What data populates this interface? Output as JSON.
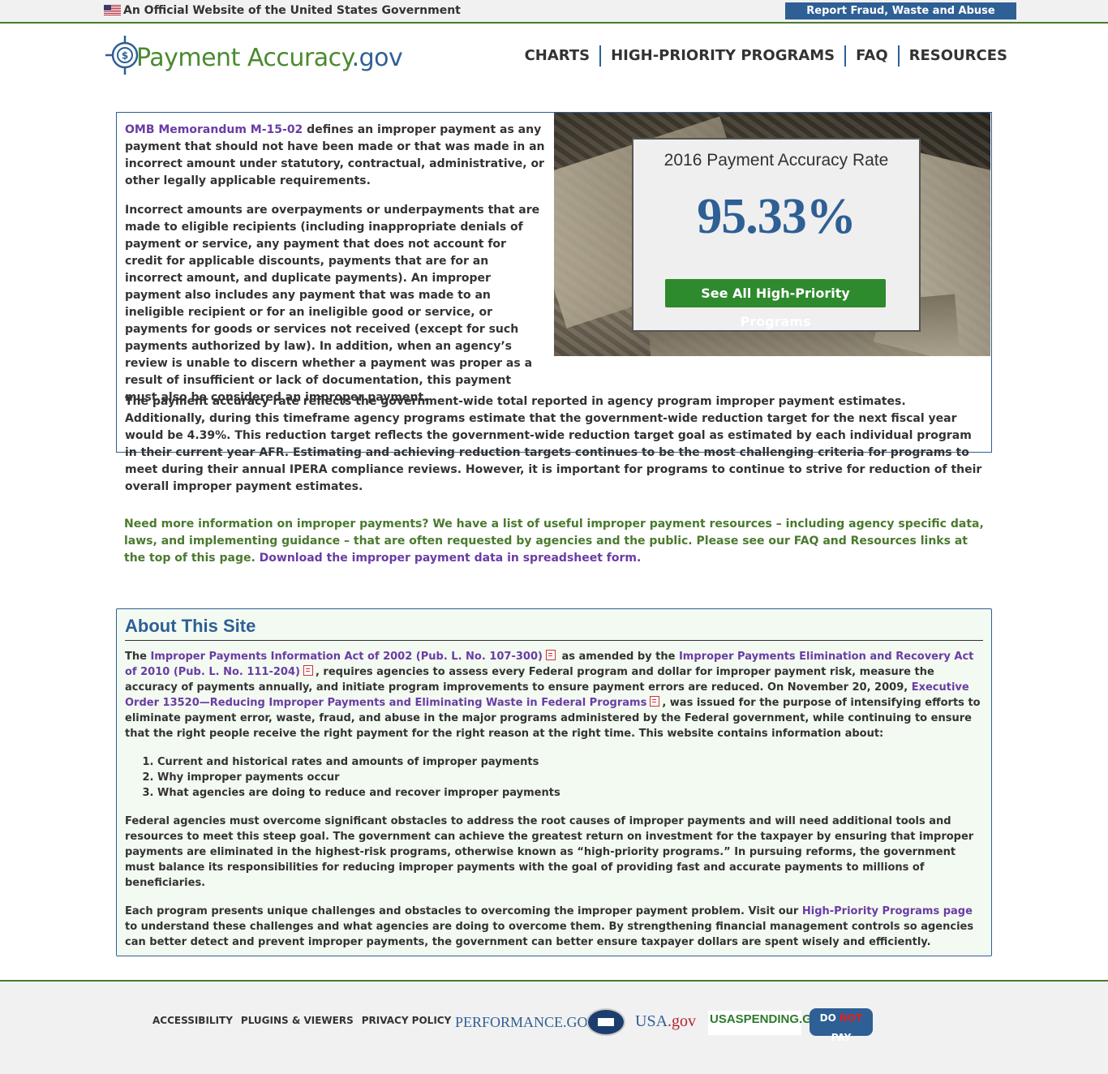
{
  "gov_bar": {
    "official_text": "An Official Website of the United States Government",
    "report_button": "Report Fraud, Waste and Abuse"
  },
  "header": {
    "logo_main": "Payment Accuracy",
    "logo_suffix": ".gov",
    "nav": [
      "CHARTS",
      "HIGH-PRIORITY PROGRAMS",
      "FAQ",
      "RESOURCES"
    ]
  },
  "intro": {
    "p1_link": "OMB Memorandum M-15-02",
    "p1_text": " defines an improper payment as any payment that should not have been made or that was made in an incorrect amount under statutory, contractual, administrative, or other legally applicable requirements.",
    "p2_text": "Incorrect amounts are overpayments or underpayments that are made to eligible recipients (including inappropriate denials of payment or service, any payment that does not account for credit for applicable discounts, payments that are for an incorrect amount, and duplicate payments). An improper payment also includes any payment that was made to an ineligible recipient or for an ineligible good or service, or payments for goods or services not received (except for such payments authorized by law). In addition, when an agency’s review is unable to discern whether a payment was proper as a result of insufficient or lack of documentation, this payment must also be considered an improper payment."
  },
  "rate_card": {
    "title": "2016 Payment Accuracy Rate",
    "value": "95.33%",
    "button": "See All High-Priority Programs"
  },
  "rate_paragraph": "The payment accuracy rate reflects the government-wide total reported in agency program improper payment estimates. Additionally, during this timeframe agency programs estimate that the government-wide reduction target for the next fiscal year would be 4.39%. This reduction target reflects the government-wide reduction target goal as estimated by each individual program in their current year AFR. Estimating and achieving reduction targets continues to be the most challenging criteria for programs to meet during their annual IPERA compliance reviews. However, it is important for programs to continue to strive for reduction of their overall improper payment estimates.",
  "more_info": {
    "text": "Need more information on improper payments? We have a list of useful improper payment resources – including agency specific data, laws, and implementing guidance – that are often requested by agencies and the public. Please see our FAQ and Resources links at the top of this page. ",
    "link": "Download the improper payment data in spreadsheet form."
  },
  "about": {
    "title": "About This Site",
    "p1_a": "The ",
    "p1_link1": "Improper Payments Information Act of 2002 (Pub. L. No. 107-300)",
    "p1_b": " as amended by the ",
    "p1_link2": "Improper Payments Elimination and Recovery Act of 2010 (Pub. L. No. 111-204)",
    "p1_c": ", requires agencies to assess every Federal program and dollar for improper payment risk, measure the accuracy of payments annually, and initiate program improvements to ensure payment errors are reduced. On November 20, 2009, ",
    "p1_link3": "Executive Order 13520—Reducing Improper Payments and Eliminating Waste in Federal Programs",
    "p1_d": ", was issued for the purpose of intensifying efforts to eliminate payment error, waste, fraud, and abuse in the major programs administered by the Federal government, while continuing to ensure that the right people receive the right payment for the right reason at the right time. This website contains information about:",
    "list": [
      "Current and historical rates and amounts of improper payments",
      "Why improper payments occur",
      "What agencies are doing to reduce and recover improper payments"
    ],
    "p2": "Federal agencies must overcome significant obstacles to address the root causes of improper payments and will need additional tools and resources to meet this steep goal. The government can achieve the greatest return on investment for the taxpayer by ensuring that improper payments are eliminated in the highest-risk programs, otherwise known as “high-priority programs.” In pursuing reforms, the government must balance its responsibilities for reducing improper payments with the goal of providing fast and accurate payments to millions of beneficiaries.",
    "p3_a": "Each program presents unique challenges and obstacles to overcoming the improper payment problem. Visit our ",
    "p3_link": "High-Priority Programs page",
    "p3_b": " to understand these challenges and what agencies are doing to overcome them. By strengthening financial management controls so agencies can better detect and prevent improper payments, the government can better ensure taxpayer dollars are spent wisely and efficiently."
  },
  "footer": {
    "links": [
      "ACCESSIBILITY",
      "PLUGINS & VIEWERS",
      "PRIVACY POLICY"
    ],
    "partners": {
      "performance": "PERFORMANCE.GOV",
      "usa_main": "USA",
      "usa_suffix": ".gov",
      "spending": "USASPENDING.GOV",
      "dnp_do": "DO ",
      "dnp_not": "NOT",
      "dnp_pay": " PAY"
    }
  }
}
